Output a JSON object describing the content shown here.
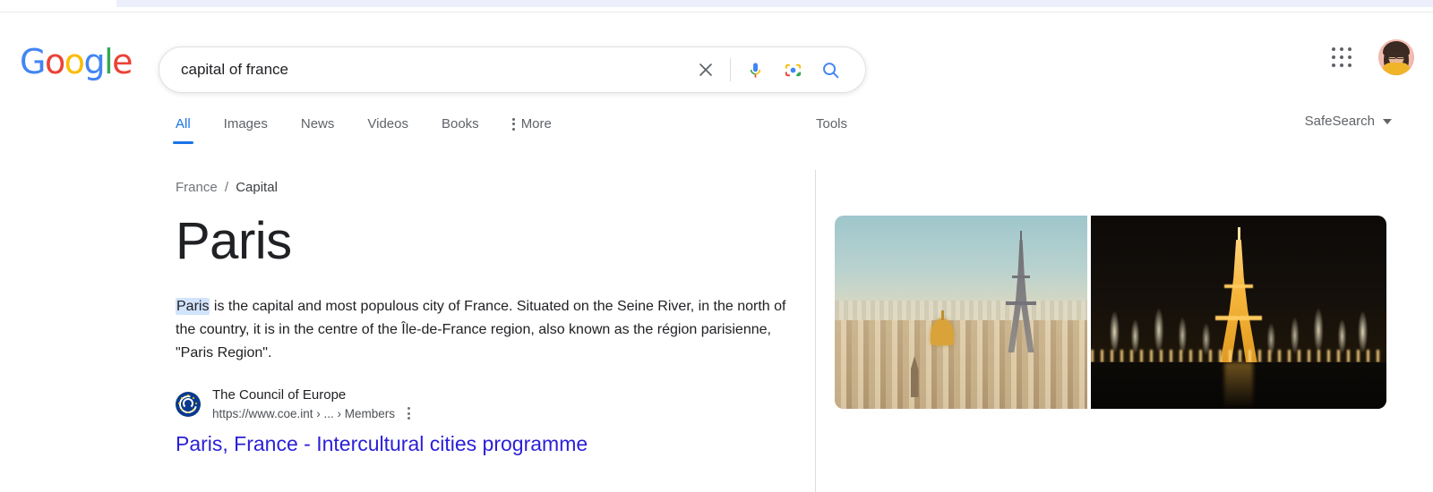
{
  "branding": {
    "logo_letters": [
      {
        "char": "G",
        "color_class": "b"
      },
      {
        "char": "o",
        "color_class": "r"
      },
      {
        "char": "o",
        "color_class": "y"
      },
      {
        "char": "g",
        "color_class": "b"
      },
      {
        "char": "l",
        "color_class": "g"
      },
      {
        "char": "e",
        "color_class": "r"
      }
    ],
    "colors": {
      "blue": "#4285F4",
      "red": "#EA4335",
      "yellow": "#FBBC05",
      "green": "#34A853",
      "link_blue": "#1a73e8",
      "visited_link": "#2a1fd6",
      "highlight": "#d2e3fc",
      "text_primary": "#202124",
      "text_secondary": "#5f6368"
    }
  },
  "search": {
    "query": "capital of france",
    "placeholder": "Search",
    "clear_icon": "close-icon",
    "voice_icon": "microphone-icon",
    "lens_icon": "google-lens-camera-icon",
    "search_icon": "search-icon"
  },
  "nav": {
    "tabs": [
      {
        "label": "All",
        "active": true
      },
      {
        "label": "Images",
        "active": false
      },
      {
        "label": "News",
        "active": false
      },
      {
        "label": "Videos",
        "active": false
      },
      {
        "label": "Books",
        "active": false
      }
    ],
    "more_label": "More",
    "more_icon": "vertical-dots-icon",
    "tools_label": "Tools",
    "safesearch_label": "SafeSearch",
    "safesearch_caret": "chevron-down-icon"
  },
  "account": {
    "apps_icon": "apps-grid-icon",
    "avatar_icon": "user-avatar"
  },
  "answer": {
    "breadcrumb": {
      "parent": "France",
      "separator": "/",
      "current": "Capital"
    },
    "title": "Paris",
    "description_highlight": "Paris",
    "description_rest": " is the capital and most populous city of France. Situated on the Seine River, in the north of the country, it is in the centre of the Île-de-France region, also known as the région parisienne, \"Paris Region\"."
  },
  "source": {
    "favicon_icon": "council-of-europe-favicon",
    "name": "The Council of Europe",
    "url": "https://www.coe.int › ... › Members",
    "menu_icon": "vertical-dots-icon",
    "result_title": "Paris, France - Intercultural cities programme"
  },
  "images": {
    "thumbnails": [
      {
        "alt": "Paris skyline daytime with Eiffel Tower and Les Invalides golden dome"
      },
      {
        "alt": "Eiffel Tower illuminated at night with Trocadero fountains"
      }
    ]
  }
}
